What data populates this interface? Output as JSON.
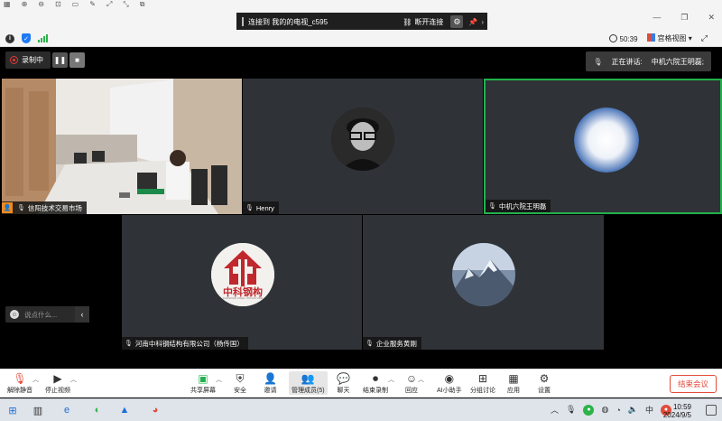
{
  "remote_bar": {
    "label": "连接到 我的的电视_c595",
    "reconnect_label": "断开连接"
  },
  "status": {
    "timer": "50:39",
    "view_label": "宫格视图"
  },
  "recording": {
    "label": "录制中"
  },
  "speaking": {
    "label": "正在讲话:",
    "name": "中机六院王明磊;"
  },
  "tiles": [
    {
      "name": "信阳技术交易市场"
    },
    {
      "name": "Henry"
    },
    {
      "name": "中机六院王明磊"
    },
    {
      "name": "河南中科钢结构有限公司（杨传国）"
    },
    {
      "name": "企业服务黄刚"
    }
  ],
  "logo": {
    "text": "中科钢构",
    "subtext": "ZHONGKE STEEL STRUCTURE"
  },
  "chat": {
    "placeholder": "说点什么..."
  },
  "toolbar": {
    "mute": "解除静音",
    "video": "停止视频",
    "share": "共享屏幕",
    "security": "安全",
    "invite": "邀请",
    "members": "管理成员(5)",
    "chat": "聊天",
    "record": "结束录制",
    "replay": "回应",
    "ai": "AI小助手",
    "breakout": "分组讨论",
    "apps": "应用",
    "settings": "设置",
    "end": "结束会议"
  },
  "taskbar": {
    "time": "10:59",
    "date": "2024/9/5"
  },
  "colors": {
    "active_border": "#23b14d",
    "end_red": "#e44b3c",
    "logo_red": "#c0282d"
  }
}
